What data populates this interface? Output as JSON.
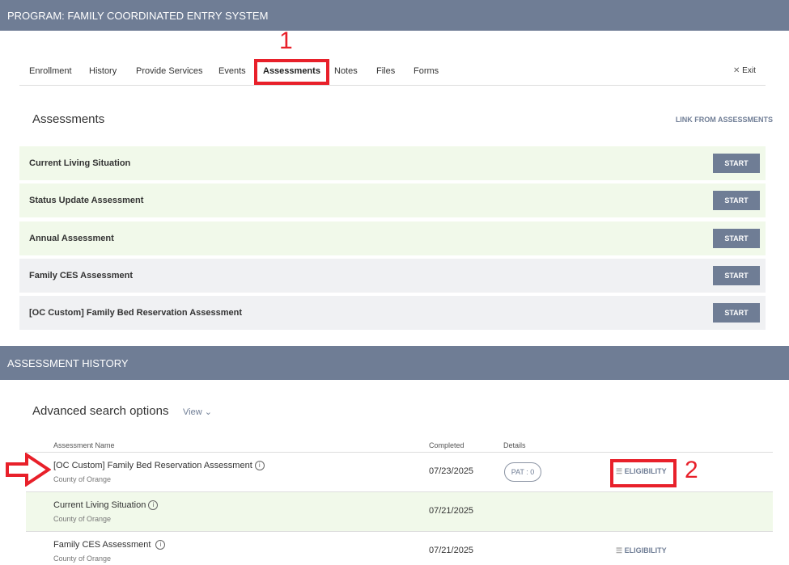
{
  "header": {
    "title": "PROGRAM: FAMILY COORDINATED ENTRY SYSTEM"
  },
  "tabs": [
    {
      "label": "Enrollment"
    },
    {
      "label": "History"
    },
    {
      "label": "Provide Services"
    },
    {
      "label": "Events"
    },
    {
      "label": "Assessments",
      "active": true
    },
    {
      "label": "Notes"
    },
    {
      "label": "Files"
    },
    {
      "label": "Forms"
    }
  ],
  "exit_label": "Exit",
  "assessments": {
    "title": "Assessments",
    "link_label": "LINK FROM ASSESSMENTS",
    "start_label": "START",
    "items": [
      {
        "name": "Current Living Situation"
      },
      {
        "name": "Status Update Assessment"
      },
      {
        "name": "Annual Assessment"
      },
      {
        "name": "Family CES Assessment"
      },
      {
        "name": "[OC Custom] Family Bed Reservation Assessment"
      }
    ]
  },
  "history": {
    "title": "ASSESSMENT HISTORY",
    "search_label": "Advanced search options",
    "view_label": "View",
    "columns": [
      "Assessment Name",
      "Completed",
      "Details"
    ],
    "rows": [
      {
        "name": "[OC Custom] Family Bed Reservation Assessment",
        "org": "County of Orange",
        "completed": "07/23/2025",
        "details": "PAT : 0",
        "action": "ELIGIBILITY"
      },
      {
        "name": "Current Living Situation",
        "org": "County of Orange",
        "completed": "07/21/2025"
      },
      {
        "name": "Family CES Assessment",
        "org": "County of Orange",
        "completed": "07/21/2025",
        "action": "ELIGIBILITY"
      }
    ]
  },
  "annotations": {
    "one": "1",
    "two": "2"
  },
  "colors": {
    "bar": "#6f7d95",
    "green_row": "#f1f9ea",
    "gray_row": "#f0f1f3",
    "annotation": "#e8202a"
  }
}
